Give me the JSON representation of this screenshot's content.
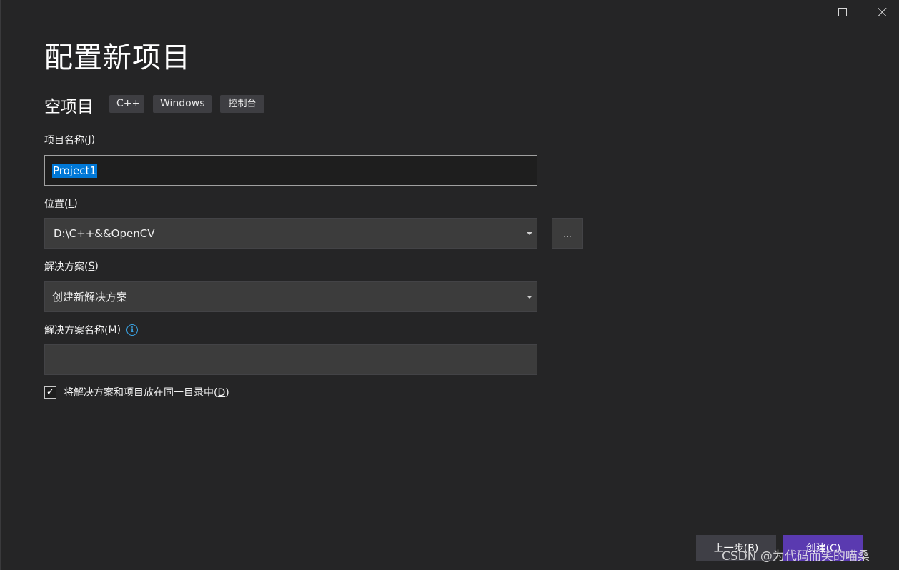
{
  "window": {
    "title": "配置新项目",
    "maximize_icon": "maximize-icon",
    "close_icon": "close-icon"
  },
  "template": {
    "name": "空项目",
    "tags": [
      "C++",
      "Windows",
      "控制台"
    ]
  },
  "fields": {
    "project_name": {
      "label_text": "项目名称(",
      "label_mnemonic": "J",
      "label_suffix": ")",
      "value": "Project1",
      "selected": true
    },
    "location": {
      "label_text": "位置(",
      "label_mnemonic": "L",
      "label_suffix": ")",
      "value": "D:\\C++&&OpenCV"
    },
    "solution": {
      "label_text": "解决方案(",
      "label_mnemonic": "S",
      "label_suffix": ")",
      "value": "创建新解决方案"
    },
    "solution_name": {
      "label_text": "解决方案名称(",
      "label_mnemonic": "M",
      "label_suffix": ")",
      "value": "",
      "info_icon": "info-icon",
      "info_glyph": "i"
    }
  },
  "browse_button": {
    "label": "..."
  },
  "same_dir_checkbox": {
    "checked": true,
    "label_text": "将解决方案和项目放在同一目录中(",
    "label_mnemonic": "D",
    "label_suffix": ")"
  },
  "footer": {
    "back_label": "上一步(B)",
    "create_label": "创建(C)"
  },
  "watermark": {
    "text": "CSDN @为代码而笑的喵桑"
  },
  "colors": {
    "background": "#252526",
    "selection": "#0078d7",
    "primary_button": "#5a3ab0",
    "info_icon": "#3aa3e3"
  }
}
